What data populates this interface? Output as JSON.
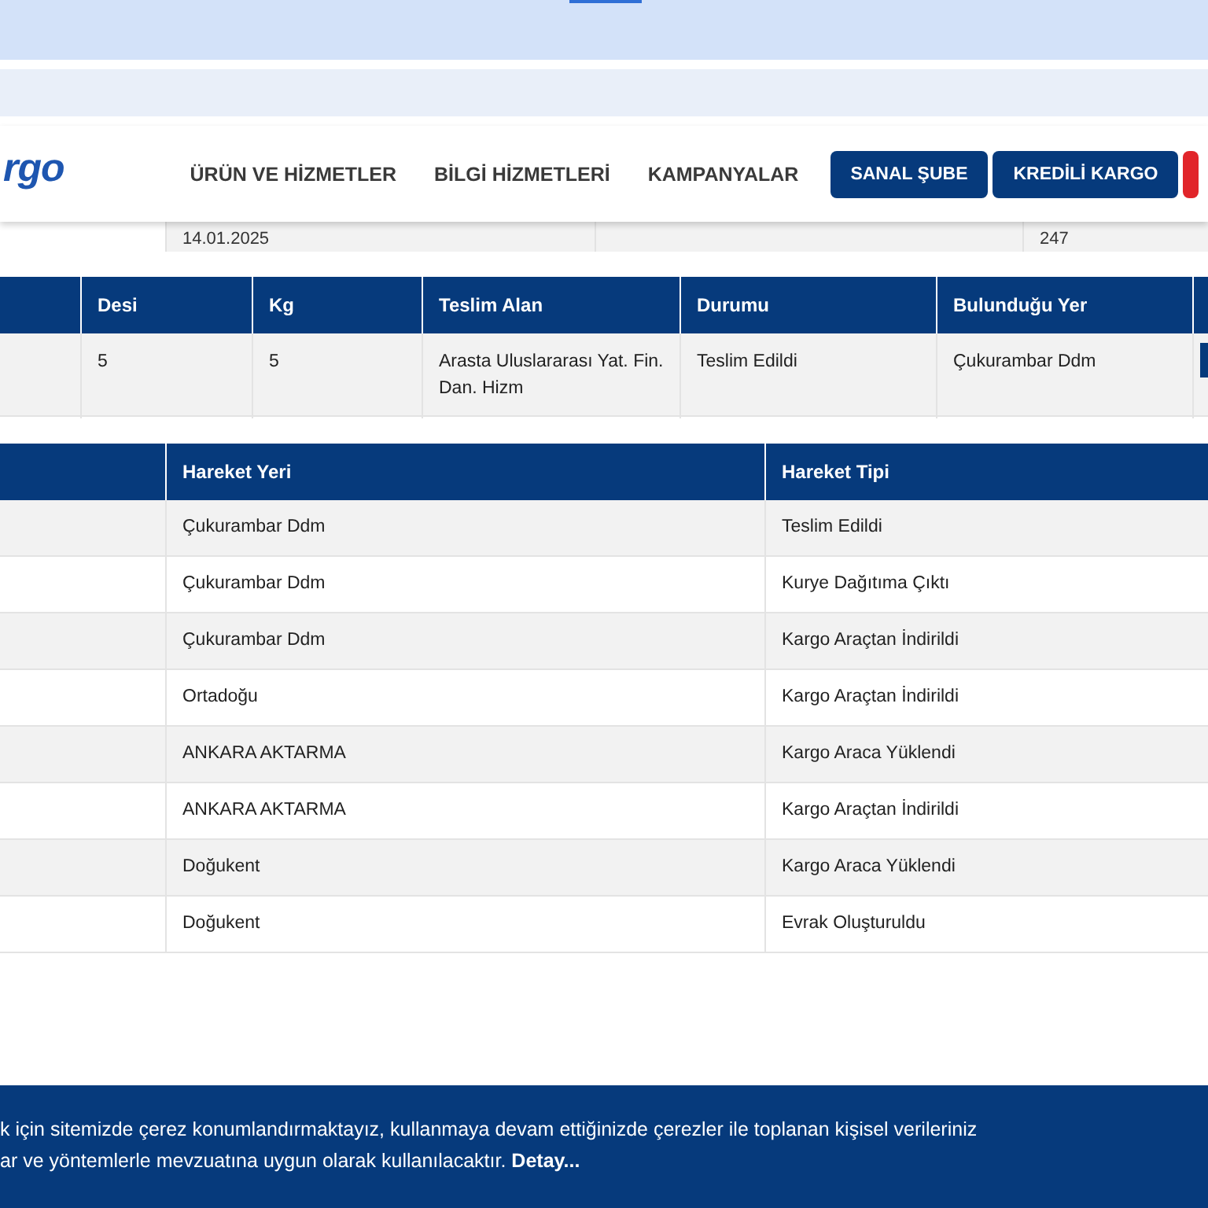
{
  "logo": {
    "text": "rgo"
  },
  "nav": {
    "links": [
      {
        "label": "ÜRÜN VE HİZMETLER"
      },
      {
        "label": "BİLGİ HİZMETLERİ"
      },
      {
        "label": "KAMPANYALAR"
      }
    ],
    "buttons": [
      {
        "label": "SANAL ŞUBE",
        "kind": "primary"
      },
      {
        "label": "KREDİLİ KARGO",
        "kind": "primary"
      },
      {
        "kind": "accent"
      }
    ]
  },
  "summary_row": {
    "cells": [
      null,
      "14.01.2025",
      null,
      "247"
    ]
  },
  "shipment_table": {
    "columns": [
      null,
      "Desi",
      "Kg",
      "Teslim Alan",
      "Durumu",
      "Bulunduğu Yer",
      null
    ],
    "rows": [
      {
        "cells": [
          null,
          "5",
          "5",
          "Arasta Uluslararası Yat. Fin. Dan. Hizm",
          "Teslim Edildi",
          "Çukurambar Ddm",
          null
        ],
        "has_action": true
      }
    ]
  },
  "movement_table": {
    "columns": [
      null,
      "Hareket Yeri",
      "Hareket Tipi"
    ],
    "rows": [
      {
        "cells": [
          null,
          "Çukurambar Ddm",
          "Teslim Edildi"
        ]
      },
      {
        "cells": [
          null,
          "Çukurambar Ddm",
          "Kurye Dağıtıma Çıktı"
        ]
      },
      {
        "cells": [
          null,
          "Çukurambar Ddm",
          "Kargo Araçtan İndirildi"
        ]
      },
      {
        "cells": [
          null,
          "Ortadoğu",
          "Kargo Araçtan İndirildi"
        ]
      },
      {
        "cells": [
          null,
          "ANKARA AKTARMA",
          "Kargo Araca Yüklendi"
        ]
      },
      {
        "cells": [
          null,
          "ANKARA AKTARMA",
          "Kargo Araçtan İndirildi"
        ]
      },
      {
        "cells": [
          null,
          "Doğukent",
          "Kargo Araca Yüklendi"
        ]
      },
      {
        "cells": [
          null,
          "Doğukent",
          "Evrak Oluşturuldu"
        ]
      }
    ]
  },
  "cookie_banner": {
    "lines": [
      "k için sitemizde çerez konumlandırmaktayız, kullanmaya devam ettiğinizde çerezler ile toplanan kişisel verileriniz",
      "ar ve yöntemlerle mevzuatına uygun olarak kullanılacaktır. **Detay...**"
    ]
  }
}
